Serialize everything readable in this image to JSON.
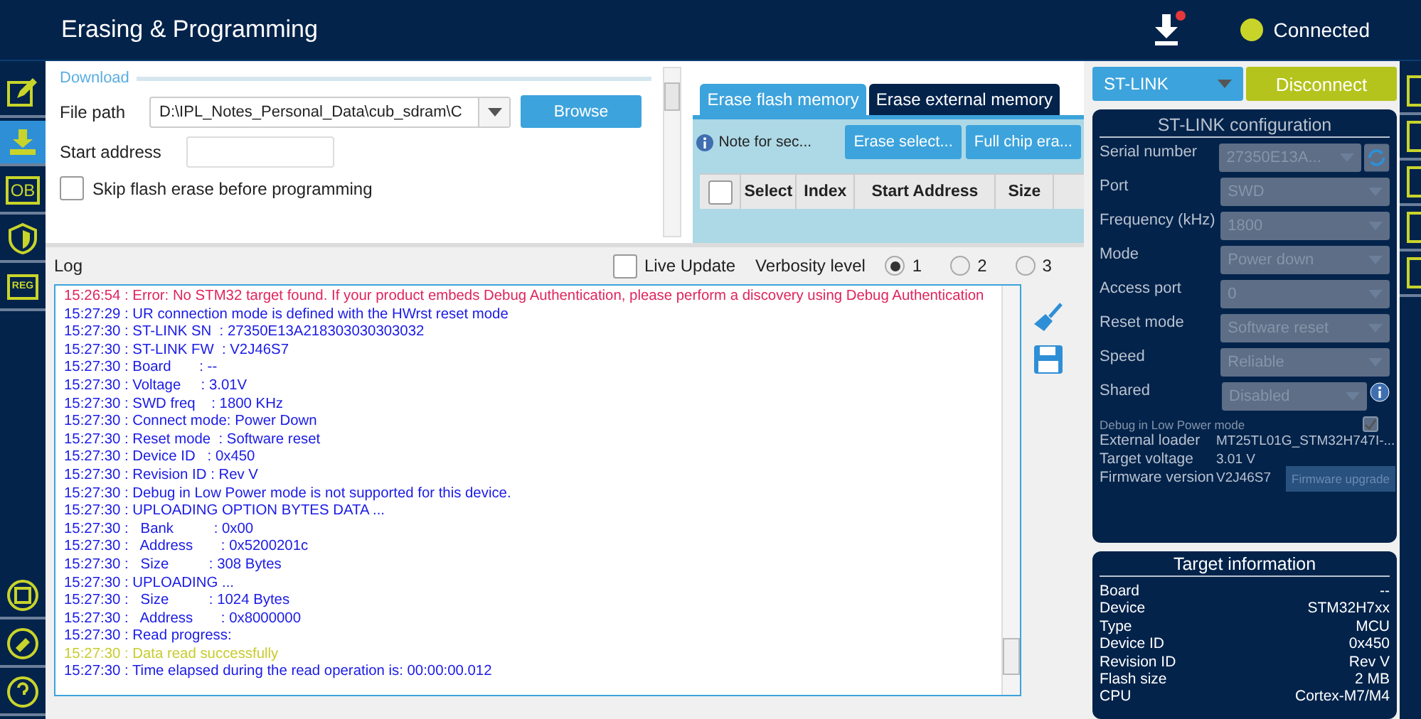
{
  "header": {
    "title": "Erasing & Programming",
    "connection": "Connected"
  },
  "sidebar": {
    "items": [
      {
        "kind": "edit",
        "selected": false
      },
      {
        "kind": "download",
        "selected": true
      },
      {
        "kind": "ob",
        "label": "OB",
        "selected": false
      },
      {
        "kind": "shield",
        "selected": false
      },
      {
        "kind": "reg",
        "label": "REG",
        "selected": false
      }
    ],
    "bottom_items": [
      {
        "kind": "el"
      },
      {
        "kind": "key"
      },
      {
        "kind": "help"
      }
    ]
  },
  "download": {
    "title": "Download",
    "file_path_label": "File path",
    "file_path": "D:\\IPL_Notes_Personal_Data\\cub_sdram\\C",
    "browse": "Browse",
    "start_address_label": "Start address",
    "skip_erase": {
      "label": "Skip flash erase before programming",
      "checked": false
    }
  },
  "erase": {
    "tabs": [
      {
        "label": "Erase flash memory",
        "selected": true
      },
      {
        "label": "Erase external memory",
        "selected": false
      }
    ],
    "note": "Note for sec...",
    "buttons": [
      "Erase select...",
      "Full chip era..."
    ],
    "select_all_checked": false,
    "columns": [
      "Select",
      "Index",
      "Start Address",
      "Size"
    ]
  },
  "log": {
    "title": "Log",
    "live_update": {
      "label": "Live Update",
      "checked": false
    },
    "verbosity_label": "Verbosity level",
    "verbosity": [
      {
        "label": "1",
        "selected": true
      },
      {
        "label": "2",
        "selected": false
      },
      {
        "label": "3",
        "selected": false
      }
    ],
    "lines": [
      {
        "text": "15:26:54 : Error: No STM32 target found. If your product embeds Debug Authentication, please perform a discovery using Debug Authentication",
        "kind": "error"
      },
      {
        "text": "15:27:29 : UR connection mode is defined with the HWrst reset mode",
        "kind": "info"
      },
      {
        "text": "15:27:30 : ST-LINK SN  : 27350E13A218303030303032",
        "kind": "info"
      },
      {
        "text": "15:27:30 : ST-LINK FW  : V2J46S7",
        "kind": "info"
      },
      {
        "text": "15:27:30 : Board       : --",
        "kind": "info"
      },
      {
        "text": "15:27:30 : Voltage     : 3.01V",
        "kind": "info"
      },
      {
        "text": "15:27:30 : SWD freq    : 1800 KHz",
        "kind": "info"
      },
      {
        "text": "15:27:30 : Connect mode: Power Down",
        "kind": "info"
      },
      {
        "text": "15:27:30 : Reset mode  : Software reset",
        "kind": "info"
      },
      {
        "text": "15:27:30 : Device ID   : 0x450",
        "kind": "info"
      },
      {
        "text": "15:27:30 : Revision ID : Rev V",
        "kind": "info"
      },
      {
        "text": "15:27:30 : Debug in Low Power mode is not supported for this device.",
        "kind": "info"
      },
      {
        "text": "15:27:30 : UPLOADING OPTION BYTES DATA ...",
        "kind": "info"
      },
      {
        "text": "15:27:30 :   Bank          : 0x00",
        "kind": "info"
      },
      {
        "text": "15:27:30 :   Address       : 0x5200201c",
        "kind": "info"
      },
      {
        "text": "15:27:30 :   Size          : 308 Bytes",
        "kind": "info"
      },
      {
        "text": "15:27:30 : UPLOADING ...",
        "kind": "info"
      },
      {
        "text": "15:27:30 :   Size          : 1024 Bytes",
        "kind": "info"
      },
      {
        "text": "15:27:30 :   Address       : 0x8000000",
        "kind": "info"
      },
      {
        "text": "15:27:30 : Read progress:",
        "kind": "info"
      },
      {
        "text": "15:27:30 : Data read successfully",
        "kind": "success"
      },
      {
        "text": "15:27:30 : Time elapsed during the read operation is: 00:00:00.012",
        "kind": "info"
      }
    ]
  },
  "connection": {
    "interface": "ST-LINK",
    "disconnect": "Disconnect"
  },
  "stlink_config": {
    "title": "ST-LINK configuration",
    "fields": [
      {
        "label": "Serial number",
        "value": "27350E13A...",
        "kind": "refresh"
      },
      {
        "label": "Port",
        "value": "SWD",
        "kind": "plain"
      },
      {
        "label": "Frequency (kHz)",
        "value": "1800",
        "kind": "plain"
      },
      {
        "label": "Mode",
        "value": "Power down",
        "kind": "plain"
      },
      {
        "label": "Access port",
        "value": "0",
        "kind": "plain"
      },
      {
        "label": "Reset mode",
        "value": "Software reset",
        "kind": "plain"
      },
      {
        "label": "Speed",
        "value": "Reliable",
        "kind": "plain"
      },
      {
        "label": "Shared",
        "value": "Disabled",
        "kind": "info"
      }
    ],
    "debug_low_power": {
      "label": "Debug in Low Power mode",
      "checked": true
    },
    "info": [
      {
        "label": "External loader",
        "value": "MT25TL01G_STM32H747I-..."
      },
      {
        "label": "Target voltage",
        "value": "3.01 V"
      },
      {
        "label": "Firmware version",
        "value": "V2J46S7"
      }
    ],
    "firmware_upgrade": "Firmware upgrade"
  },
  "target_information": {
    "title": "Target information",
    "rows": [
      {
        "label": "Board",
        "value": "--"
      },
      {
        "label": "Device",
        "value": "STM32H7xx"
      },
      {
        "label": "Type",
        "value": "MCU"
      },
      {
        "label": "Device ID",
        "value": "0x450"
      },
      {
        "label": "Revision ID",
        "value": "Rev V"
      },
      {
        "label": "Flash size",
        "value": "2 MB"
      },
      {
        "label": "CPU",
        "value": "Cortex-M7/M4"
      }
    ]
  }
}
